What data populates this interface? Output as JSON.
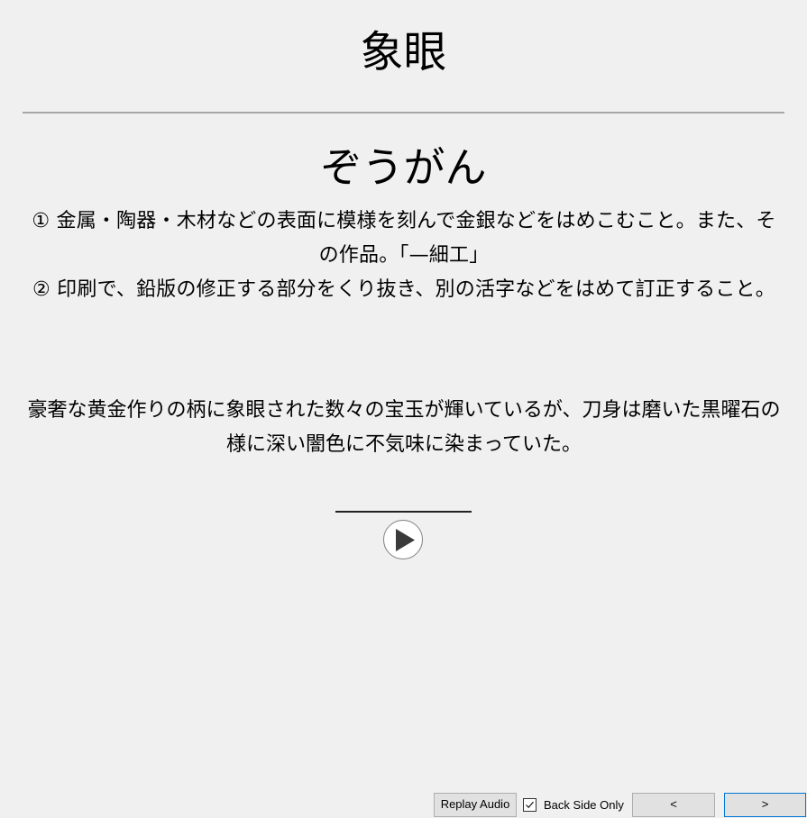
{
  "card": {
    "front_word": "象眼",
    "reading": "ぞうがん",
    "definitions": [
      "① 金属・陶器・木材などの表面に模様を刻んで金銀などをはめこむこと。また、その作品。「—細工」",
      "② 印刷で、鉛版の修正する部分をくり抜き、別の活字などをはめて訂正すること。"
    ],
    "example_sentence": "豪奢な黄金作りの柄に象眼された数々の宝玉が輝いているが、刀身は磨いた黒曜石の様に深い闇色に不気味に染まっていた。",
    "audio": {
      "icon": "play-icon"
    }
  },
  "controls": {
    "replay_audio_label": "Replay Audio",
    "back_side_only_label": "Back Side Only",
    "back_side_only_checked": true,
    "prev_label": "<",
    "next_label": ">"
  }
}
